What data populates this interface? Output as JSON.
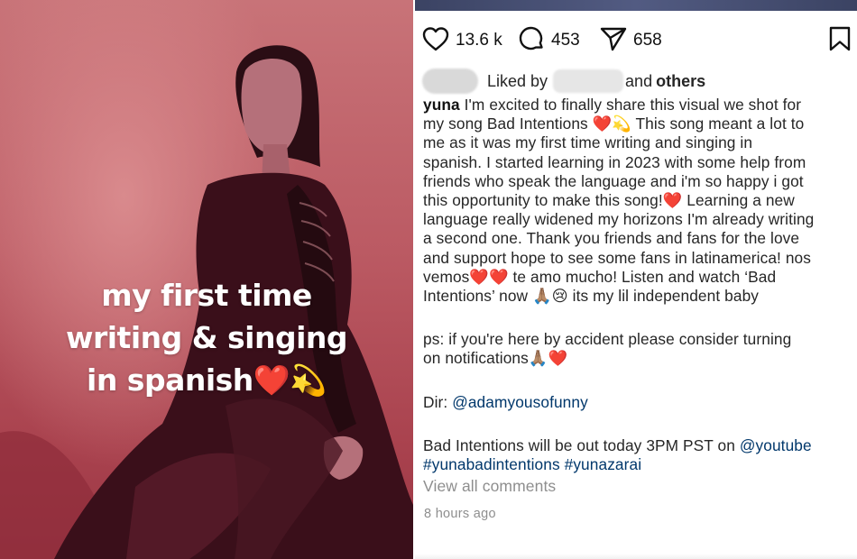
{
  "overlay": {
    "lines": [
      "my first time",
      "writing & singing",
      "in spanish"
    ],
    "emojis": [
      "❤️",
      "💫"
    ]
  },
  "actions": {
    "likes": "13.6 k",
    "comments": "453",
    "shares": "658"
  },
  "liked_by": {
    "prefix": "Liked by",
    "and_text": "and",
    "others": "others"
  },
  "caption": {
    "username": "yuna",
    "lines": [
      " I'm excited to finally share this visual we shot for",
      "my song Bad Intentions ❤️💫 This song meant a lot to",
      "me as it was my first time writing and singing in",
      "spanish. I started learning in 2023 with some help from",
      "friends who speak the language and i'm so happy i got",
      "this opportunity to make this song!❤️ Learning a new",
      "language really widened my horizons I'm already writing",
      "a second one. Thank you friends and fans for the love",
      "and support hope to see some fans in latinamerica! nos",
      "vemos❤️❤️ te amo mucho! Listen and watch ‘Bad",
      "Intentions’ now 🙏🏽😢 its my lil independent baby"
    ],
    "ps_lines": [
      "ps: if you're here by accident please consider turning",
      "on notifications🙏🏽❤️"
    ],
    "dir_prefix": "Dir: ",
    "dir_handle": "@adamyousofunny",
    "release_text": "Bad Intentions will be out today 3PM PST on ",
    "release_handle": "@youtube",
    "hashtag_1": "#yunabadintentions",
    "hashtag_2": "#yunazarai",
    "view_all": "View all comments",
    "time_ago": "8 hours ago"
  },
  "colors": {
    "link": "#00376b",
    "muted": "#8e8e8e",
    "text": "#262626",
    "heart": "#e0202e"
  },
  "icons": {
    "like": "heart-outline-icon",
    "comment": "speech-bubble-icon",
    "share": "paper-plane-icon",
    "save": "bookmark-icon"
  }
}
